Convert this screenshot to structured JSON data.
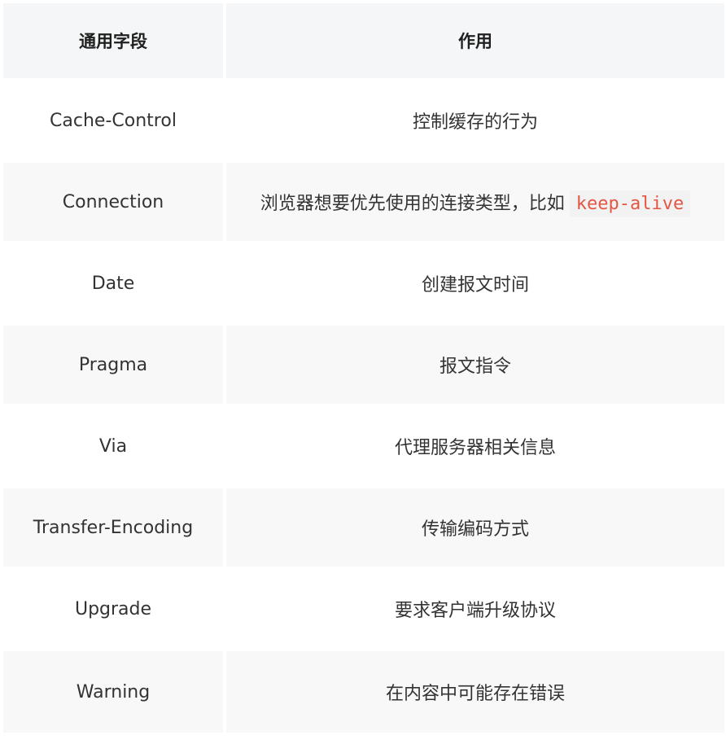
{
  "table": {
    "headers": [
      "通用字段",
      "作用"
    ],
    "rows": [
      {
        "field": "Cache-Control",
        "desc": "控制缓存的行为",
        "code": ""
      },
      {
        "field": "Connection",
        "desc": "浏览器想要优先使用的连接类型，比如",
        "code": "keep-alive"
      },
      {
        "field": "Date",
        "desc": "创建报文时间",
        "code": ""
      },
      {
        "field": "Pragma",
        "desc": "报文指令",
        "code": ""
      },
      {
        "field": "Via",
        "desc": "代理服务器相关信息",
        "code": ""
      },
      {
        "field": "Transfer-Encoding",
        "desc": "传输编码方式",
        "code": ""
      },
      {
        "field": "Upgrade",
        "desc": "要求客户端升级协议",
        "code": ""
      },
      {
        "field": "Warning",
        "desc": "在内容中可能存在错误",
        "code": ""
      }
    ]
  },
  "colors": {
    "header_bg": "#f5f6f7",
    "row_alt_bg": "#f8f8f8",
    "code_text": "#e45644",
    "code_bg": "#f2f2f2"
  }
}
